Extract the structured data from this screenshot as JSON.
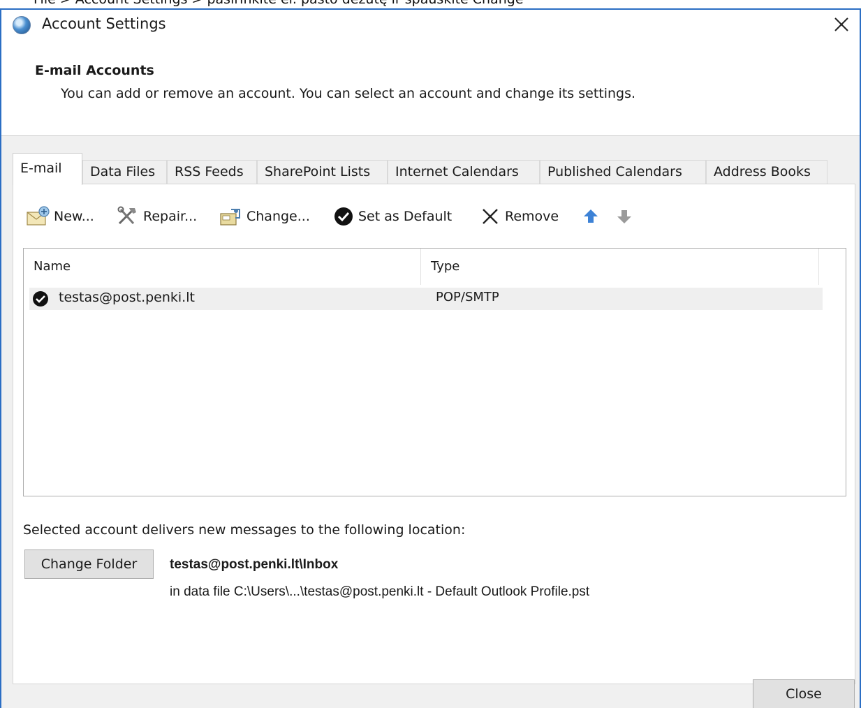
{
  "caption": "File > Account Settings > pasirinkite el. pašto dėžutę ir spauskite Change",
  "window": {
    "title": "Account Settings"
  },
  "header": {
    "title": "E-mail Accounts",
    "description": "You can add or remove an account. You can select an account and change its settings."
  },
  "tabs": [
    {
      "label": "E-mail",
      "active": true
    },
    {
      "label": "Data Files"
    },
    {
      "label": "RSS Feeds"
    },
    {
      "label": "SharePoint Lists"
    },
    {
      "label": "Internet Calendars"
    },
    {
      "label": "Published Calendars"
    },
    {
      "label": "Address Books"
    }
  ],
  "toolbar": {
    "new": "New...",
    "repair": "Repair...",
    "change": "Change...",
    "set_default": "Set as Default",
    "remove": "Remove"
  },
  "list": {
    "columns": [
      "Name",
      "Type"
    ],
    "rows": [
      {
        "name": "testas@post.penki.lt",
        "type": "POP/SMTP",
        "default": true
      }
    ]
  },
  "delivery": {
    "label": "Selected account delivers new messages to the following location:",
    "change_folder": "Change Folder",
    "folder": "testas@post.penki.lt\\Inbox",
    "data_file": "in data file C:\\Users\\...\\testas@post.penki.lt - Default Outlook Profile.pst"
  },
  "footer": {
    "close": "Close"
  },
  "colors": {
    "window_border": "#2b6ec4",
    "up_arrow": "#3d82d6",
    "down_arrow": "#9a9a9a"
  }
}
